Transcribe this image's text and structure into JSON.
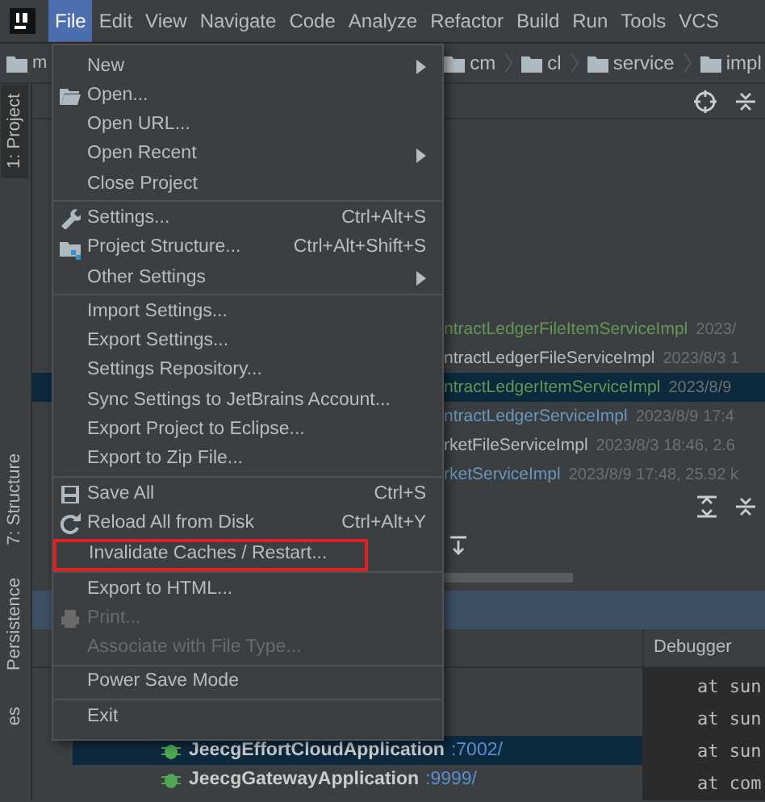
{
  "menubar": {
    "items": [
      {
        "label": "File",
        "selected": true
      },
      {
        "label": "Edit",
        "selected": false
      },
      {
        "label": "View",
        "selected": false
      },
      {
        "label": "Navigate",
        "selected": false
      },
      {
        "label": "Code",
        "selected": false
      },
      {
        "label": "Analyze",
        "selected": false
      },
      {
        "label": "Refactor",
        "selected": false
      },
      {
        "label": "Build",
        "selected": false
      },
      {
        "label": "Run",
        "selected": false
      },
      {
        "label": "Tools",
        "selected": false
      },
      {
        "label": "VCS",
        "selected": false
      }
    ]
  },
  "breadcrumb": {
    "project": "m",
    "crumbs": [
      "cm",
      "cl",
      "service",
      "impl"
    ]
  },
  "tool_windows": [
    {
      "label": "1: Project",
      "selected": true
    },
    {
      "label": "7: Structure",
      "selected": false
    },
    {
      "label": "Persistence",
      "selected": false
    },
    {
      "label": "es",
      "selected": false
    }
  ],
  "files": [
    {
      "name": "ntractLedgerFileItemServiceImpl",
      "meta": "2023/",
      "color": "#629755",
      "selected": false
    },
    {
      "name": "ntractLedgerFileServiceImpl",
      "meta": "2023/8/3 1",
      "color": "#bbbbbb",
      "selected": false
    },
    {
      "name": "ntractLedgerItemServiceImpl",
      "meta": "2023/8/9",
      "color": "#629755",
      "selected": true
    },
    {
      "name": "ntractLedgerServiceImpl",
      "meta": "2023/8/9 17:4",
      "color": "#6897bb",
      "selected": false
    },
    {
      "name": "rketFileServiceImpl",
      "meta": "2023/8/3 18:46, 2.6",
      "color": "#bbbbbb",
      "selected": false
    },
    {
      "name": "rketServiceImpl",
      "meta": "2023/8/9 17:48, 25.92 k",
      "color": "#6897bb",
      "selected": false
    }
  ],
  "debug_tab": "Debugger",
  "console_lines": [
    "at sun",
    "at sun",
    "at sun",
    "at com"
  ],
  "run_configs": [
    {
      "name": "JeecgEffortCloudApplication",
      "port": ":7002/",
      "selected": true
    },
    {
      "name": "JeecgGatewayApplication",
      "port": ":9999/",
      "selected": false
    }
  ],
  "file_menu": {
    "items": [
      {
        "kind": "item",
        "label": "New",
        "submenu": true,
        "disabled": false,
        "boxed": false
      },
      {
        "kind": "item",
        "label": "Open...",
        "submenu": false,
        "disabled": false,
        "boxed": false
      },
      {
        "kind": "item",
        "label": "Open URL...",
        "submenu": false,
        "disabled": false,
        "boxed": false
      },
      {
        "kind": "item",
        "label": "Open Recent",
        "submenu": true,
        "disabled": false,
        "boxed": false
      },
      {
        "kind": "item",
        "label": "Close Project",
        "submenu": false,
        "disabled": false,
        "boxed": false
      },
      {
        "kind": "separator"
      },
      {
        "kind": "item",
        "label": "Settings...",
        "shortcut": "Ctrl+Alt+S",
        "submenu": false,
        "disabled": false,
        "boxed": false
      },
      {
        "kind": "item",
        "label": "Project Structure...",
        "shortcut": "Ctrl+Alt+Shift+S",
        "submenu": false,
        "disabled": false,
        "boxed": false
      },
      {
        "kind": "item",
        "label": "Other Settings",
        "submenu": true,
        "disabled": false,
        "boxed": false
      },
      {
        "kind": "separator"
      },
      {
        "kind": "item",
        "label": "Import Settings...",
        "submenu": false,
        "disabled": false,
        "boxed": false
      },
      {
        "kind": "item",
        "label": "Export Settings...",
        "submenu": false,
        "disabled": false,
        "boxed": false
      },
      {
        "kind": "item",
        "label": "Settings Repository...",
        "submenu": false,
        "disabled": false,
        "boxed": false
      },
      {
        "kind": "item",
        "label": "Sync Settings to JetBrains Account...",
        "submenu": false,
        "disabled": false,
        "boxed": false
      },
      {
        "kind": "item",
        "label": "Export Project to Eclipse...",
        "submenu": false,
        "disabled": false,
        "boxed": false
      },
      {
        "kind": "item",
        "label": "Export to Zip File...",
        "submenu": false,
        "disabled": false,
        "boxed": false
      },
      {
        "kind": "separator"
      },
      {
        "kind": "item",
        "label": "Save All",
        "shortcut": "Ctrl+S",
        "submenu": false,
        "disabled": false,
        "boxed": false
      },
      {
        "kind": "item",
        "label": "Reload All from Disk",
        "shortcut": "Ctrl+Alt+Y",
        "submenu": false,
        "disabled": false,
        "boxed": false
      },
      {
        "kind": "item",
        "label": "Invalidate Caches / Restart...",
        "submenu": false,
        "disabled": false,
        "boxed": true
      },
      {
        "kind": "separator"
      },
      {
        "kind": "item",
        "label": "Export to HTML...",
        "submenu": false,
        "disabled": false,
        "boxed": false
      },
      {
        "kind": "item",
        "label": "Print...",
        "submenu": false,
        "disabled": true,
        "boxed": false
      },
      {
        "kind": "item",
        "label": "Associate with File Type...",
        "submenu": false,
        "disabled": true,
        "boxed": false
      },
      {
        "kind": "separator"
      },
      {
        "kind": "item",
        "label": "Power Save Mode",
        "submenu": false,
        "disabled": false,
        "boxed": false
      },
      {
        "kind": "separator"
      },
      {
        "kind": "item",
        "label": "Exit",
        "submenu": false,
        "disabled": false,
        "boxed": false
      }
    ]
  }
}
